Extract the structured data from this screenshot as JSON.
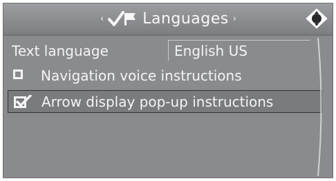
{
  "header": {
    "title": "Languages",
    "left_arrow": "‹",
    "right_arrow": "›",
    "icon": "check-flag-icon",
    "menu_icon": "controller-knob-icon"
  },
  "settings": {
    "text_language": {
      "label": "Text language",
      "value": "English US"
    },
    "navigation_voice": {
      "label": "Navigation voice instructions",
      "checked": false
    },
    "arrow_display": {
      "label": "Arrow display pop-up instructions",
      "checked": true,
      "selected": true
    }
  },
  "colors": {
    "background": "#8a8b8f",
    "header": "#85868a",
    "text": "#f4f4f4",
    "selected_row": "#7a7b7f"
  }
}
